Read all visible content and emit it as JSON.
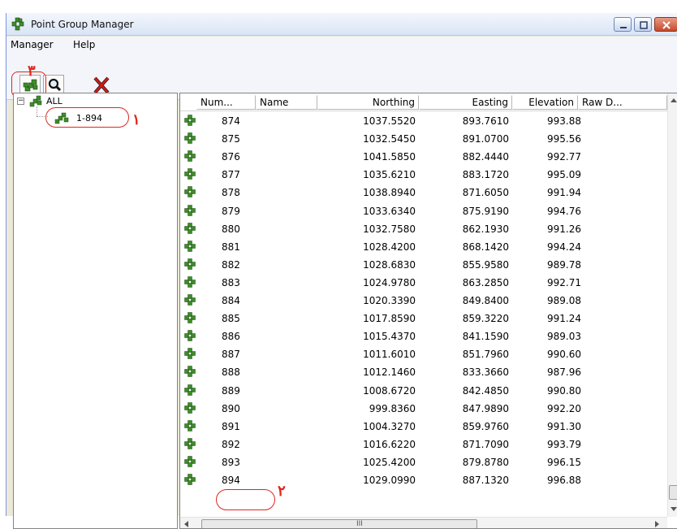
{
  "window": {
    "title": "Point Group Manager",
    "title_icon": "point-group-icon"
  },
  "menu": {
    "items": [
      {
        "label": "Manager"
      },
      {
        "label": "Help"
      }
    ]
  },
  "toolbar": {
    "buttons": [
      {
        "icon": "point-group-icon"
      },
      {
        "icon": "magnifier-icon"
      },
      {
        "icon": "delete-x-icon"
      }
    ]
  },
  "annotations": {
    "n1": "۱",
    "n2": "۲",
    "n3": "۳",
    "color": "#e0261c"
  },
  "tree": {
    "root_label": "ALL",
    "expander": "−",
    "group_label": "1-894"
  },
  "grid": {
    "columns": [
      "Num...",
      "Name",
      "Northing",
      "Easting",
      "Elevation",
      "Raw D..."
    ],
    "rows": [
      {
        "num": "874",
        "northing": "1037.5520",
        "easting": "893.7610",
        "elevation": "993.88"
      },
      {
        "num": "875",
        "northing": "1032.5450",
        "easting": "891.0700",
        "elevation": "995.56"
      },
      {
        "num": "876",
        "northing": "1041.5850",
        "easting": "882.4440",
        "elevation": "992.77"
      },
      {
        "num": "877",
        "northing": "1035.6210",
        "easting": "883.1720",
        "elevation": "995.09"
      },
      {
        "num": "878",
        "northing": "1038.8940",
        "easting": "871.6050",
        "elevation": "991.94"
      },
      {
        "num": "879",
        "northing": "1033.6340",
        "easting": "875.9190",
        "elevation": "994.76"
      },
      {
        "num": "880",
        "northing": "1032.7580",
        "easting": "862.1930",
        "elevation": "991.26"
      },
      {
        "num": "881",
        "northing": "1028.4200",
        "easting": "868.1420",
        "elevation": "994.24"
      },
      {
        "num": "882",
        "northing": "1028.6830",
        "easting": "855.9580",
        "elevation": "989.78"
      },
      {
        "num": "883",
        "northing": "1024.9780",
        "easting": "863.2850",
        "elevation": "992.71"
      },
      {
        "num": "884",
        "northing": "1020.3390",
        "easting": "849.8400",
        "elevation": "989.08"
      },
      {
        "num": "885",
        "northing": "1017.8590",
        "easting": "859.3220",
        "elevation": "991.24"
      },
      {
        "num": "886",
        "northing": "1015.4370",
        "easting": "841.1590",
        "elevation": "989.03"
      },
      {
        "num": "887",
        "northing": "1011.6010",
        "easting": "851.7960",
        "elevation": "990.60"
      },
      {
        "num": "888",
        "northing": "1012.1460",
        "easting": "833.3660",
        "elevation": "987.96"
      },
      {
        "num": "889",
        "northing": "1008.6720",
        "easting": "842.4850",
        "elevation": "990.80"
      },
      {
        "num": "890",
        "northing": "999.8360",
        "easting": "847.9890",
        "elevation": "992.20"
      },
      {
        "num": "891",
        "northing": "1004.3270",
        "easting": "859.9760",
        "elevation": "991.30"
      },
      {
        "num": "892",
        "northing": "1016.6220",
        "easting": "871.7090",
        "elevation": "993.79"
      },
      {
        "num": "893",
        "northing": "1025.4200",
        "easting": "879.8780",
        "elevation": "996.15"
      },
      {
        "num": "894",
        "northing": "1029.0990",
        "easting": "887.1320",
        "elevation": "996.88"
      }
    ]
  },
  "scrollbar": {
    "grip": "III"
  },
  "colors": {
    "point_icon": "#3e8c2a",
    "annotation": "#e0261c",
    "window_bg": "#ece9d8"
  }
}
